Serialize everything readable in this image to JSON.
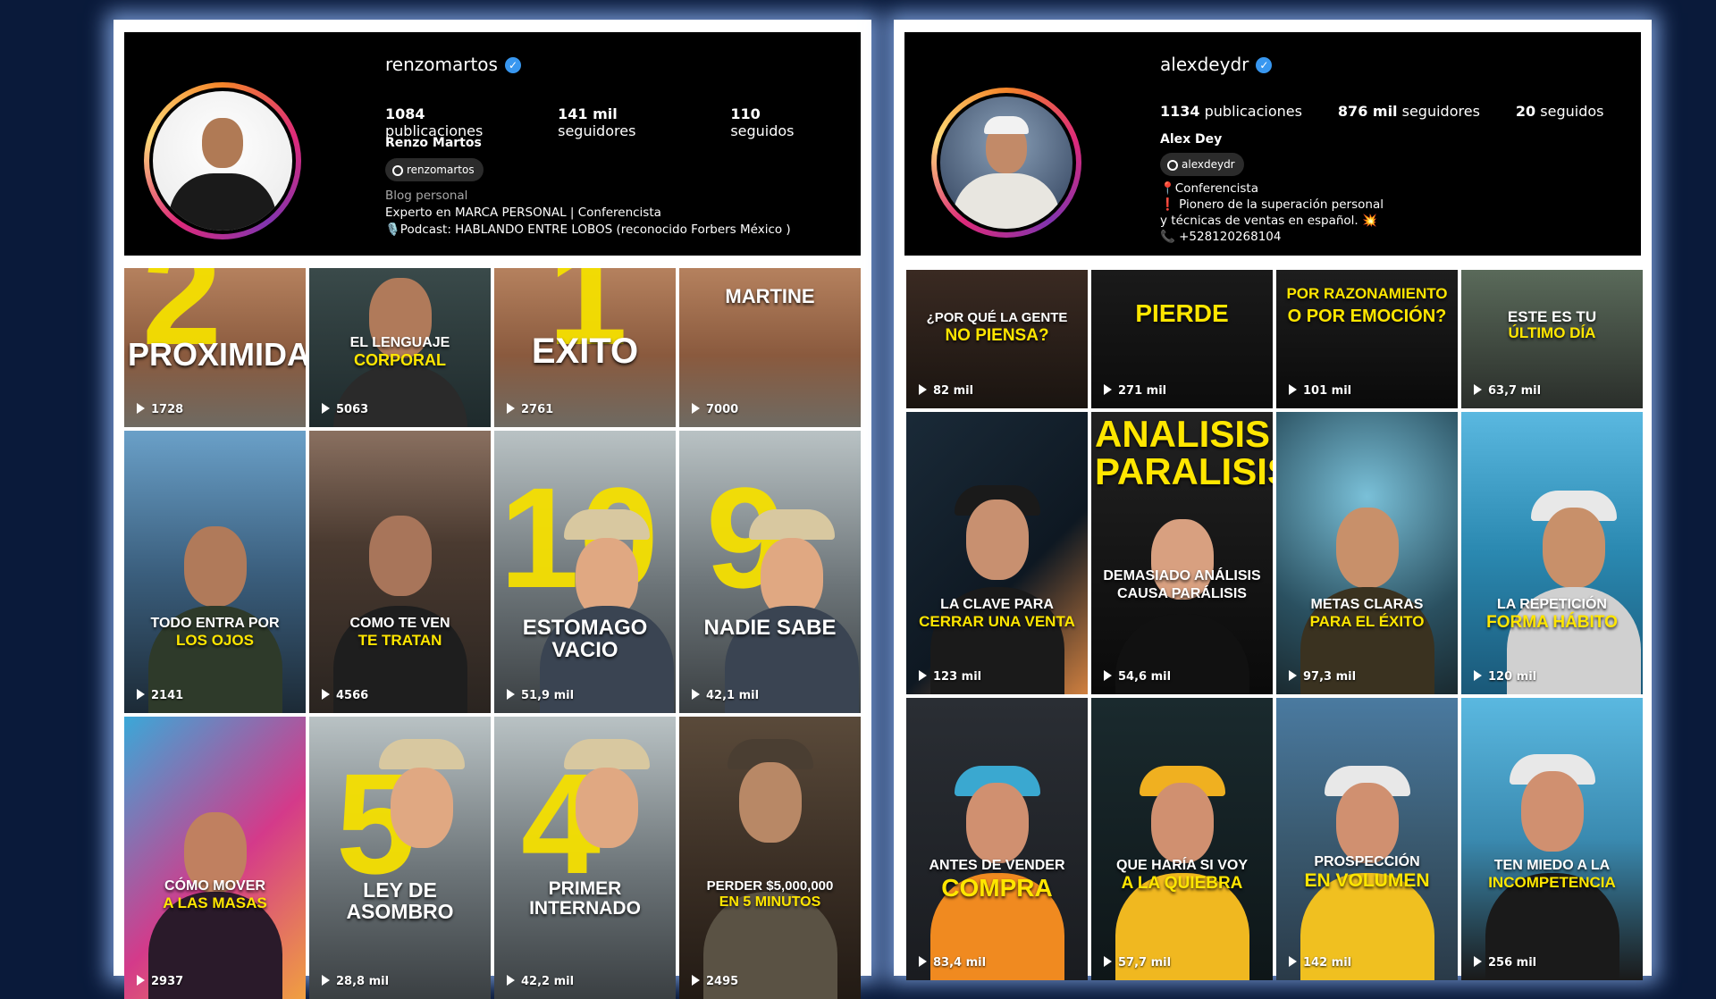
{
  "left_profile": {
    "username": "renzomartos",
    "stats": {
      "posts_value": "1084",
      "posts_label": "publicaciones",
      "followers_value": "141 mil",
      "followers_label": "seguidores",
      "following_value": "110",
      "following_label": "seguidos"
    },
    "full_name": "Renzo Martos",
    "threads_handle": "renzomartos",
    "category": "Blog personal",
    "bio_lines": [
      "Experto en MARCA PERSONAL | Conferencista",
      "🎙️Podcast: HABLANDO ENTRE LOBOS (reconocido Forbers México )"
    ],
    "tiles": [
      {
        "line1": "PROXIMIDAD",
        "line2": "",
        "big": "2",
        "plays": "1728"
      },
      {
        "line1": "EL LENGUAJE",
        "line2": "CORPORAL",
        "big": "",
        "plays": "5063"
      },
      {
        "line1": "EXITO",
        "line2": "",
        "big": "1",
        "plays": "2761"
      },
      {
        "line1": "MARTINE",
        "line2": "",
        "big": "",
        "plays": "7000"
      },
      {
        "line1": "TODO ENTRA POR",
        "line2": "LOS OJOS",
        "big": "",
        "plays": "2141"
      },
      {
        "line1": "COMO TE VEN",
        "line2": "TE TRATAN",
        "big": "",
        "plays": "4566"
      },
      {
        "line1": "ESTOMAGO VACIO",
        "line2": "",
        "big": "10",
        "plays": "51,9 mil"
      },
      {
        "line1": "NADIE SABE",
        "line2": "",
        "big": "9",
        "plays": "42,1 mil"
      },
      {
        "line1": "CÓMO MOVER",
        "line2": "A LAS MASAS",
        "big": "",
        "plays": "2937"
      },
      {
        "line1": "LEY DE ASOMBRO",
        "line2": "",
        "big": "5",
        "plays": "28,8 mil"
      },
      {
        "line1": "PRIMER INTERNADO",
        "line2": "",
        "big": "4",
        "plays": "42,2 mil"
      },
      {
        "line1": "PERDER $5,000,000",
        "line2": "EN 5 MINUTOS",
        "big": "",
        "plays": "2495"
      }
    ]
  },
  "right_profile": {
    "username": "alexdeydr",
    "stats": {
      "posts_value": "1134",
      "posts_label": "publicaciones",
      "followers_value": "876 mil",
      "followers_label": "seguidores",
      "following_value": "20",
      "following_label": "seguidos"
    },
    "full_name": "Alex Dey",
    "threads_handle": "alexdeydr",
    "bio_lines": [
      "📍Conferencista",
      "❗ Pionero de la superación personal",
      "y técnicas de ventas en español. 💥",
      "📞 +528120268104"
    ],
    "tiles": [
      {
        "line1": "¿POR QUÉ LA GENTE",
        "line2": "NO PIENSA?",
        "plays": "82 mil"
      },
      {
        "line1": "",
        "line2": "PIERDE",
        "plays": "271 mil"
      },
      {
        "line1": "POR RAZONAMIENTO",
        "line2": "O POR EMOCIÓN?",
        "plays": "101 mil"
      },
      {
        "line1": "ESTE ES TU",
        "line2": "ÚLTIMO DÍA",
        "plays": "63,7 mil"
      },
      {
        "line1": "LA CLAVE PARA",
        "line2": "CERRAR UNA VENTA",
        "plays": "123 mil"
      },
      {
        "line1": "DEMASIADO ANÁLISIS",
        "line2": "CAUSA PARÁLISIS",
        "top_title": "ANALISIS PARALISIS",
        "plays": "54,6 mil"
      },
      {
        "line1": "METAS CLARAS",
        "line2": "PARA EL ÉXITO",
        "plays": "97,3 mil"
      },
      {
        "line1": "LA REPETICIÓN",
        "line2": "FORMA HÁBITO",
        "plays": "120 mil"
      },
      {
        "line1": "ANTES DE VENDER",
        "line2": "COMPRA",
        "plays": "83,4 mil"
      },
      {
        "line1": "QUE HARÍA SI VOY",
        "line2": "A LA QUIEBRA",
        "plays": "57,7 mil"
      },
      {
        "line1": "PROSPECCIÓN",
        "line2": "EN VOLUMEN",
        "plays": "142 mil"
      },
      {
        "line1": "TEN MIEDO A LA",
        "line2": "INCOMPETENCIA",
        "plays": "256 mil"
      }
    ]
  },
  "colors": {
    "background": "#0a1a3a",
    "accent_yellow": "#ffe600",
    "verified_blue": "#3897f0"
  }
}
